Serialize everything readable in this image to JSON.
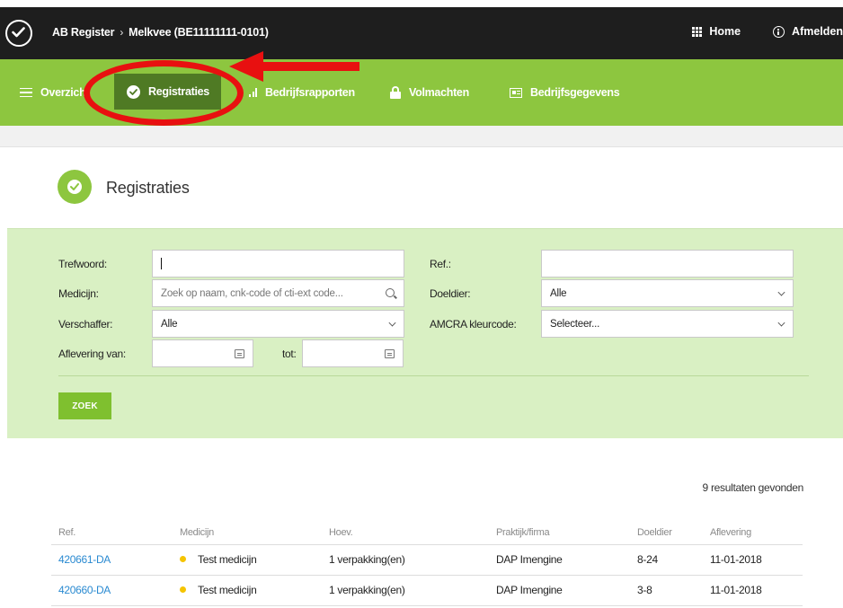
{
  "topbar": {
    "breadcrumb": [
      "AB Register",
      "Melkvee (BE11111111-0101)"
    ],
    "breadcrumb_sep": "›",
    "home_label": "Home",
    "logout_label": "Afmelden"
  },
  "nav": {
    "items": [
      {
        "label": "Overzicht",
        "icon": "list-icon"
      },
      {
        "label": "Registraties",
        "icon": "check-circle-icon",
        "active": true
      },
      {
        "label": "Bedrijfsrapporten",
        "icon": "bar-chart-icon"
      },
      {
        "label": "Volmachten",
        "icon": "lock-icon"
      },
      {
        "label": "Bedrijfsgegevens",
        "icon": "id-card-icon"
      }
    ]
  },
  "page": {
    "title": "Registraties"
  },
  "filters": {
    "trefwoord_label": "Trefwoord:",
    "trefwoord_value": "",
    "medicijn_label": "Medicijn:",
    "medicijn_placeholder": "Zoek op naam, cnk-code of cti-ext code...",
    "verschaffer_label": "Verschaffer:",
    "verschaffer_value": "Alle",
    "aflevering_van_label": "Aflevering van:",
    "aflevering_van_value": "",
    "tot_label": "tot:",
    "tot_value": "",
    "ref_label": "Ref.:",
    "ref_value": "",
    "doeldier_label": "Doeldier:",
    "doeldier_value": "Alle",
    "amcra_label": "AMCRA kleurcode:",
    "amcra_value": "Selecteer...",
    "search_button": "ZOEK"
  },
  "results": {
    "count_text": "9 resultaten gevonden",
    "columns": [
      "Ref.",
      "Medicijn",
      "Hoev.",
      "Praktijk/firma",
      "Doeldier",
      "Aflevering"
    ],
    "rows": [
      {
        "ref": "420661-DA",
        "medicijn": "Test medicijn",
        "dot_color": "#f5c400",
        "hoev": "1 verpakking(en)",
        "praktijk": "DAP Imengine",
        "doeldier": "8-24",
        "aflevering": "11-01-2018"
      },
      {
        "ref": "420660-DA",
        "medicijn": "Test medicijn",
        "dot_color": "#f5c400",
        "hoev": "1 verpakking(en)",
        "praktijk": "DAP Imengine",
        "doeldier": "3-8",
        "aflevering": "11-01-2018"
      }
    ]
  },
  "colors": {
    "nav_green": "#8dc63f",
    "active_tab": "#4f7a24",
    "filter_bg": "#d9f0c3",
    "link_blue": "#2a8ad1",
    "annotation_red": "#e81010"
  }
}
